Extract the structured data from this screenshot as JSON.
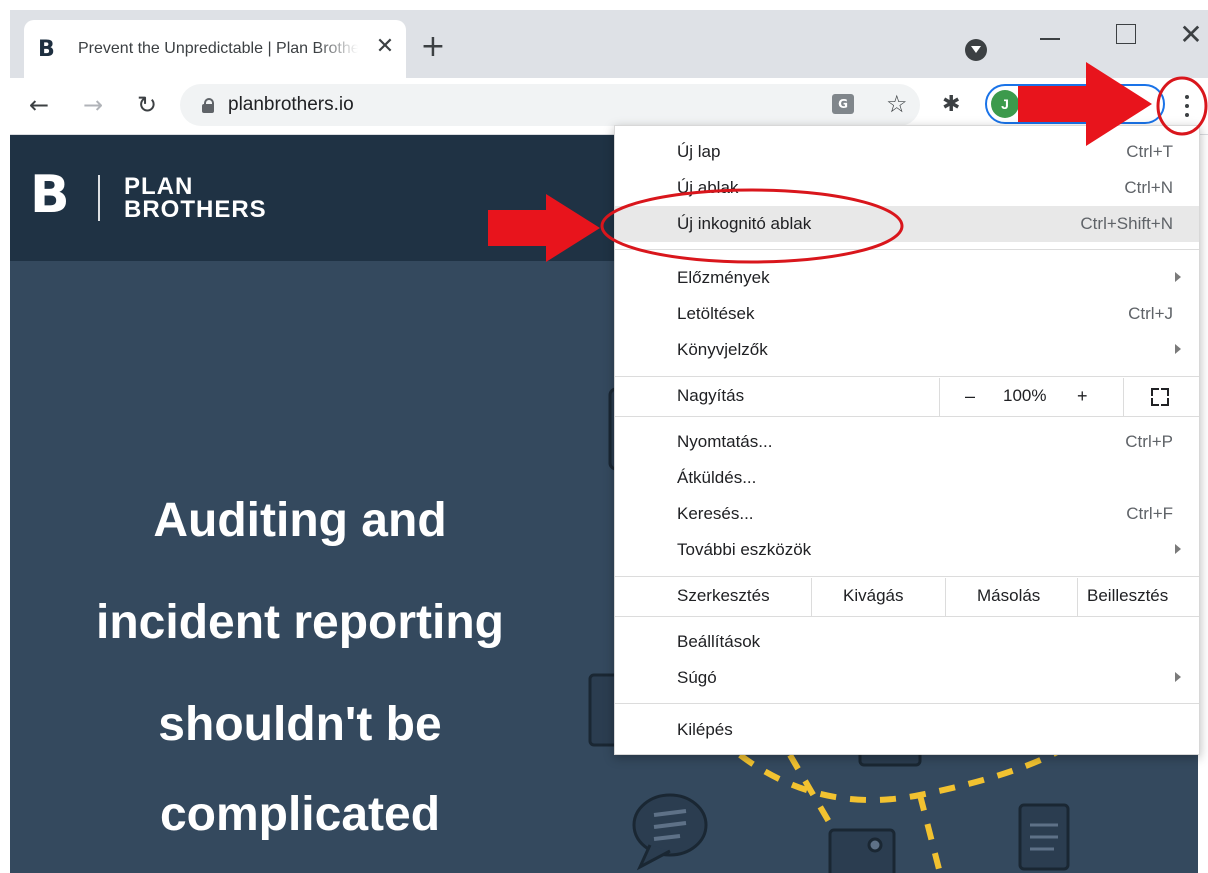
{
  "browser": {
    "tab": {
      "title": "Prevent the Unpredictable | Plan Brothers",
      "favicon_icon": "planbrothers-logo-icon"
    },
    "url": "planbrothers.io",
    "avatar_initial": "J",
    "icons": [
      "back-arrow-icon",
      "forward-arrow-icon",
      "reload-icon",
      "lock-icon",
      "translate-icon",
      "star-icon",
      "extensions-puzzle-icon",
      "kebab-menu-icon"
    ]
  },
  "site": {
    "logo_text_line1": "PLAN",
    "logo_text_line2": "BROTHERS",
    "hero_lines": [
      "Auditing and",
      "incident reporting",
      "shouldn't be",
      "complicated"
    ]
  },
  "menu": {
    "new_tab": {
      "label": "Új lap",
      "shortcut": "Ctrl+T"
    },
    "new_window": {
      "label": "Új ablak",
      "shortcut": "Ctrl+N"
    },
    "incognito": {
      "label": "Új inkognitó ablak",
      "shortcut": "Ctrl+Shift+N"
    },
    "history": {
      "label": "Előzmények"
    },
    "downloads": {
      "label": "Letöltések",
      "shortcut": "Ctrl+J"
    },
    "bookmarks": {
      "label": "Könyvjelzők"
    },
    "zoom": {
      "label": "Nagyítás",
      "minus": "–",
      "value": "100%",
      "plus": "+"
    },
    "print": {
      "label": "Nyomtatás...",
      "shortcut": "Ctrl+P"
    },
    "cast": {
      "label": "Átküldés..."
    },
    "find": {
      "label": "Keresés...",
      "shortcut": "Ctrl+F"
    },
    "more_tools": {
      "label": "További eszközök"
    },
    "edit": {
      "label": "Szerkesztés",
      "cut": "Kivágás",
      "copy": "Másolás",
      "paste": "Beillesztés"
    },
    "settings": {
      "label": "Beállítások"
    },
    "help": {
      "label": "Súgó"
    },
    "exit": {
      "label": "Kilépés"
    }
  },
  "colors": {
    "highlight_red": "#e8141c",
    "page_bg": "#34495e",
    "header_bg": "#1f3244",
    "accent_yellow": "#f2c230"
  }
}
